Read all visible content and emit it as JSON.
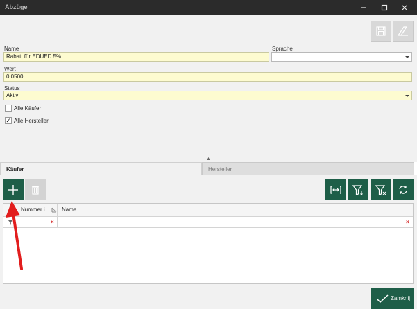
{
  "window": {
    "title": "Abzüge",
    "buttons": [
      "minimize",
      "maximize",
      "close"
    ]
  },
  "toolbar": {
    "save_icon": "save-icon",
    "clear_icon": "eraser-icon"
  },
  "form": {
    "name_label": "Name",
    "name_value": "Rabatt für EDUED 5%",
    "language_label": "Sprache",
    "language_value": "",
    "value_label": "Wert",
    "value_value": "0,0500",
    "status_label": "Status",
    "status_value": "Aktiv",
    "all_buyers_label": "Alle Käufer",
    "all_buyers_checked": false,
    "all_manufacturers_label": "Alle Hersteller",
    "all_manufacturers_checked": true,
    "all_manufacturers_check_glyph": "✓"
  },
  "tabs": [
    {
      "label": "Käufer",
      "active": true
    },
    {
      "label": "Hersteller",
      "active": false
    }
  ],
  "grid": {
    "columns": [
      "Nummer i...",
      "Name"
    ],
    "clear_glyph": "×"
  },
  "footer": {
    "close_label": "Zamknij"
  },
  "colors": {
    "accent": "#1e5e48",
    "required_field": "#fdfbd0",
    "titlebar": "#2b2b2b"
  }
}
